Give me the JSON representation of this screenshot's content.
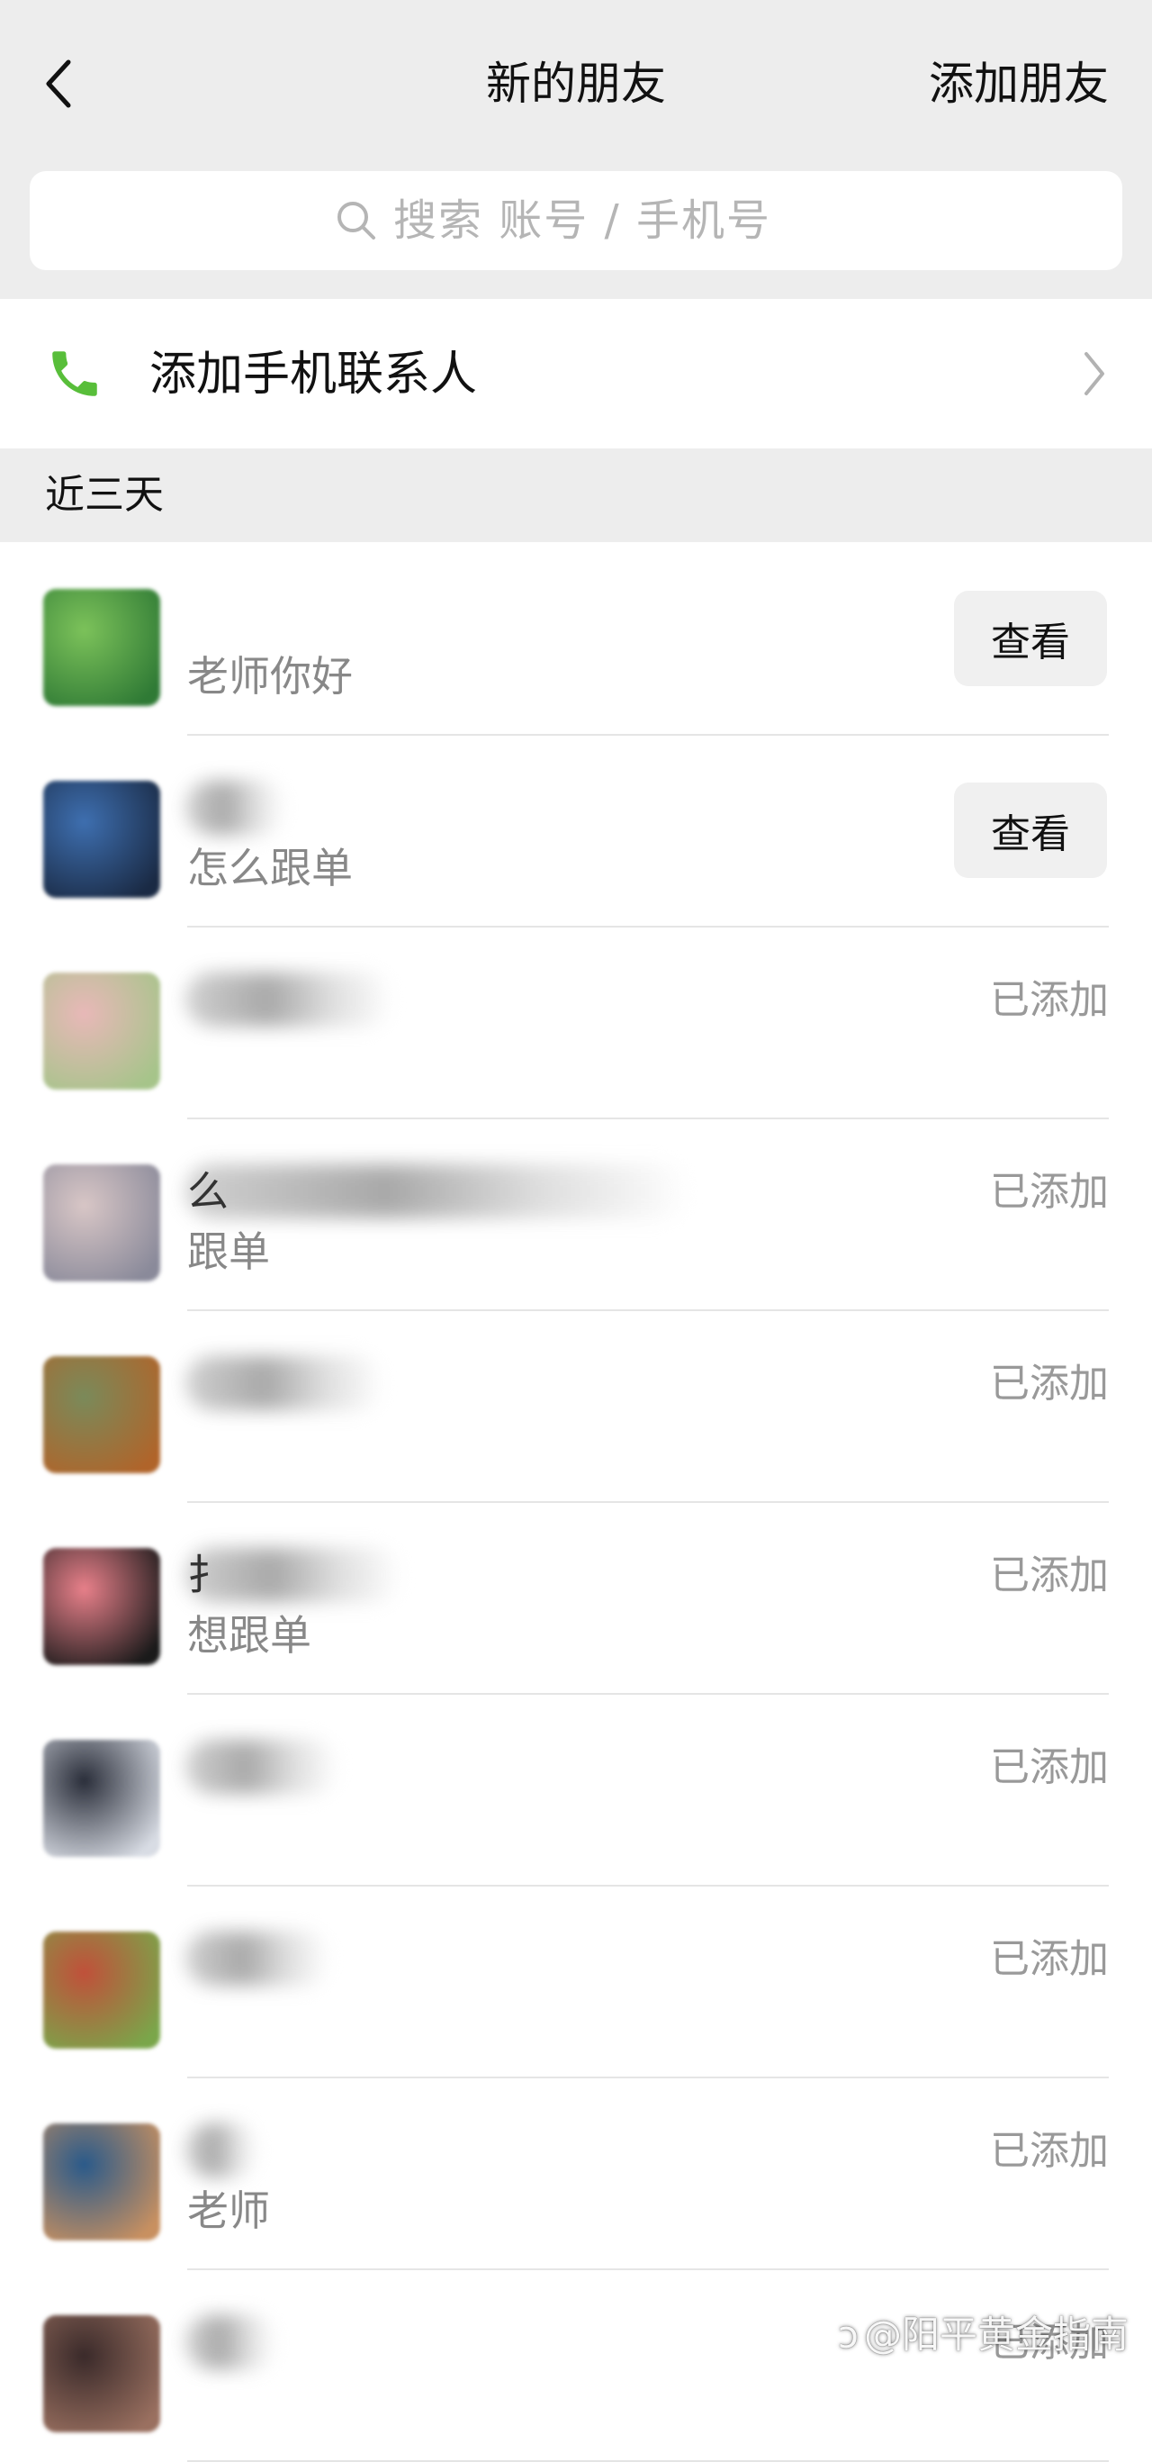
{
  "header": {
    "title": "新的朋友",
    "add_friend_label": "添加朋友",
    "back_icon": "chevron-left-icon",
    "background": "#ededed"
  },
  "search": {
    "placeholder": "搜索 账号 / 手机号",
    "icon": "search-icon"
  },
  "phone_contacts": {
    "label": "添加手机联系人",
    "icon": "phone-icon",
    "icon_color": "#58be3a",
    "chevron_icon": "chevron-right-icon"
  },
  "section": {
    "title": "近三天"
  },
  "requests": [
    {
      "name": "",
      "message": "老师你好",
      "action": "查看",
      "action_type": "button",
      "avatar_colors": [
        "#7cc25a",
        "#2f7a35"
      ]
    },
    {
      "name": "",
      "message": "怎么跟单",
      "action": "查看",
      "action_type": "button",
      "avatar_colors": [
        "#3e6fb0",
        "#1a2a44"
      ]
    },
    {
      "name": "",
      "message": "",
      "action": "已添加",
      "action_type": "status",
      "avatar_colors": [
        "#e8b8b8",
        "#a6c48a"
      ]
    },
    {
      "name": "么",
      "message": "跟单",
      "action": "已添加",
      "action_type": "status",
      "avatar_colors": [
        "#d8c6c6",
        "#8a8a9a"
      ]
    },
    {
      "name": "",
      "message": "",
      "action": "已添加",
      "action_type": "status",
      "avatar_colors": [
        "#7a8a5a",
        "#b0642a"
      ]
    },
    {
      "name": "扌",
      "message": "想跟单",
      "action": "已添加",
      "action_type": "status",
      "avatar_colors": [
        "#e8808a",
        "#1a1a1a"
      ]
    },
    {
      "name": "",
      "message": "",
      "action": "已添加",
      "action_type": "status",
      "avatar_colors": [
        "#2a2e3a",
        "#d8dce4"
      ]
    },
    {
      "name": "",
      "message": "",
      "action": "已添加",
      "action_type": "status",
      "avatar_colors": [
        "#c0503a",
        "#7aa64a"
      ]
    },
    {
      "name": "",
      "message": "老师",
      "action": "已添加",
      "action_type": "status",
      "avatar_colors": [
        "#2a5a8a",
        "#c89060"
      ]
    },
    {
      "name": "",
      "message": "",
      "action": "已添加",
      "action_type": "status",
      "avatar_colors": [
        "#3a2a2a",
        "#9a7060"
      ]
    }
  ],
  "watermark": {
    "text": "@阳平黄金指南",
    "icon": "zhihu-logo-icon"
  }
}
